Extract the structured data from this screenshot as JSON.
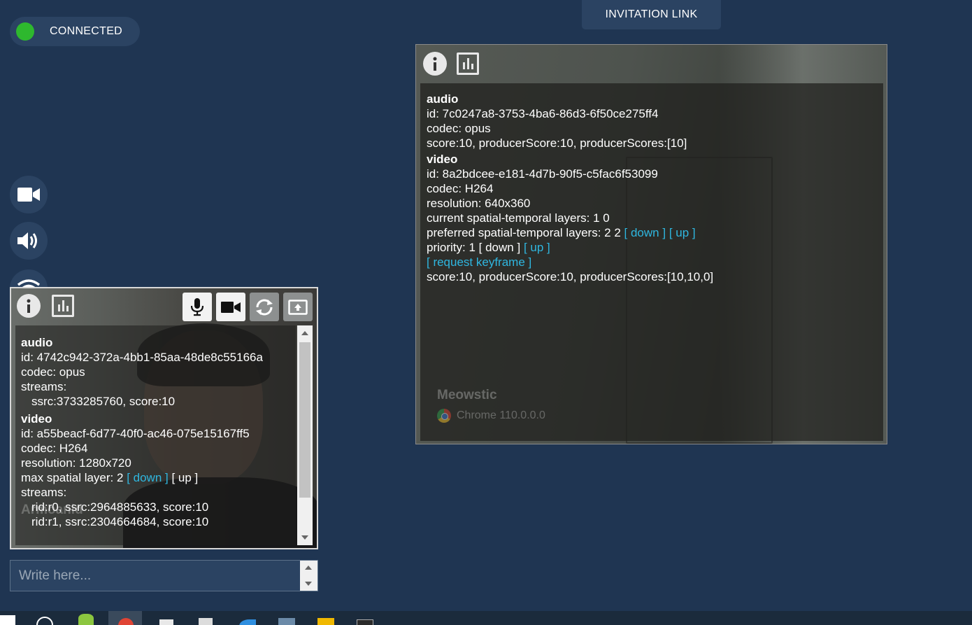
{
  "status": {
    "connection_label": "CONNECTED",
    "connection_color": "#2eb82e"
  },
  "header": {
    "invitation_label": "INVITATION LINK"
  },
  "controls": [
    {
      "name": "camera",
      "icon": "video-camera-icon"
    },
    {
      "name": "speaker",
      "icon": "speaker-icon"
    },
    {
      "name": "network",
      "icon": "wifi-icon"
    }
  ],
  "remote_peer": {
    "name": "Meowstic",
    "device": "Chrome 110.0.0.0",
    "stats": {
      "audio_heading": "audio",
      "audio_id": "id: 7c0247a8-3753-4ba6-86d3-6f50ce275ff4",
      "audio_codec": "codec: opus",
      "audio_score": "score:10, producerScore:10, producerScores:[10]",
      "video_heading": "video",
      "video_id": "id: 8a2bdcee-e181-4d7b-90f5-c5fac6f53099",
      "video_codec": "codec: H264",
      "video_resolution": "resolution: 640x360",
      "current_layers": "current spatial-temporal layers: 1 0",
      "preferred_layers": "preferred spatial-temporal layers: 2 2",
      "layer_down": "[ down ]",
      "layer_up": "[ up ]",
      "priority": "priority: 1",
      "priority_down": "[ down ]",
      "priority_up": "[ up ]",
      "request_keyframe": "[ request keyframe ]",
      "video_score": "score:10, producerScore:10, producerScores:[10,10,0]"
    }
  },
  "local_peer": {
    "name": "Armoanid",
    "stats": {
      "audio_heading": "audio",
      "audio_id": "id: 4742c942-372a-4bb1-85aa-48de8c55166a",
      "audio_codec": "codec: opus",
      "audio_streams": "streams:",
      "audio_stream_1": "ssrc:3733285760, score:10",
      "video_heading": "video",
      "video_id": "id: a55beacf-6d77-40f0-ac46-075e15167ff5",
      "video_codec": "codec: H264",
      "video_resolution": "resolution: 1280x720",
      "max_spatial": "max spatial layer: 2",
      "spatial_down": "[ down ]",
      "spatial_up": "[ up ]",
      "video_streams": "streams:",
      "video_stream_1": "rid:r0, ssrc:2964885633, score:10",
      "video_stream_2": "rid:r1, ssrc:2304664684, score:10"
    }
  },
  "chat": {
    "placeholder": "Write here..."
  }
}
